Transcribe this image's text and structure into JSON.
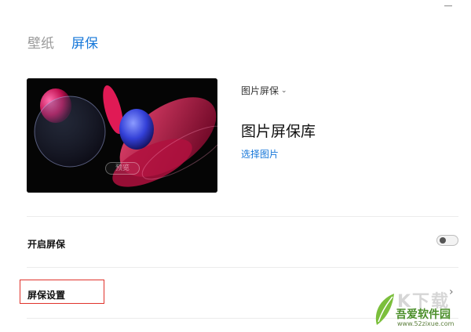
{
  "tabs": [
    {
      "label": "壁纸",
      "active": false
    },
    {
      "label": "屏保",
      "active": true
    }
  ],
  "preview": {
    "button_label": "预览"
  },
  "screensaver": {
    "type_label": "图片屏保",
    "library_title": "图片屏保库",
    "select_link": "选择图片"
  },
  "rows": {
    "enable_label": "开启屏保",
    "enable_on": false,
    "settings_label": "屏保设置"
  },
  "watermark": {
    "big_text": "K下载",
    "brand": "吾爱软件园",
    "url": "www.52zixue.com"
  },
  "colors": {
    "accent": "#1677d9",
    "highlight": "#e0322b"
  },
  "icons": [
    "minimize-icon",
    "chevron-down-icon",
    "chevron-right-icon",
    "leaf-logo-icon"
  ]
}
